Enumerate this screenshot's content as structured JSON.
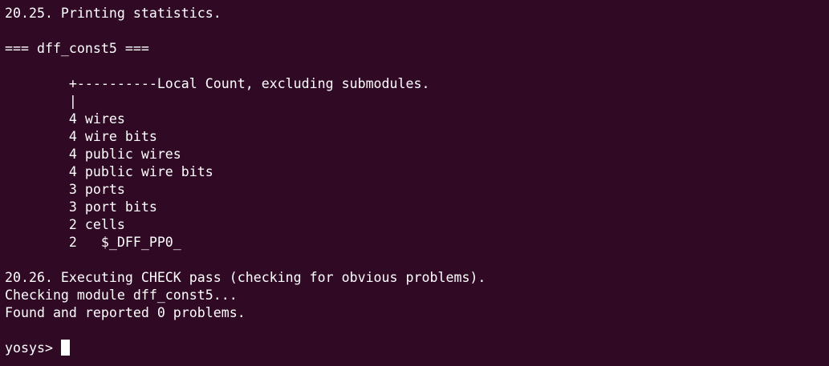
{
  "terminal": {
    "lines": [
      "20.25. Printing statistics.",
      "",
      "=== dff_const5 ===",
      "",
      "        +----------Local Count, excluding submodules.",
      "        |",
      "        4 wires",
      "        4 wire bits",
      "        4 public wires",
      "        4 public wire bits",
      "        3 ports",
      "        3 port bits",
      "        2 cells",
      "        2   $_DFF_PP0_",
      "",
      "20.26. Executing CHECK pass (checking for obvious problems).",
      "Checking module dff_const5...",
      "Found and reported 0 problems.",
      ""
    ],
    "prompt": "yosys> "
  },
  "colors": {
    "background": "#300a24",
    "text": "#ffffff"
  }
}
